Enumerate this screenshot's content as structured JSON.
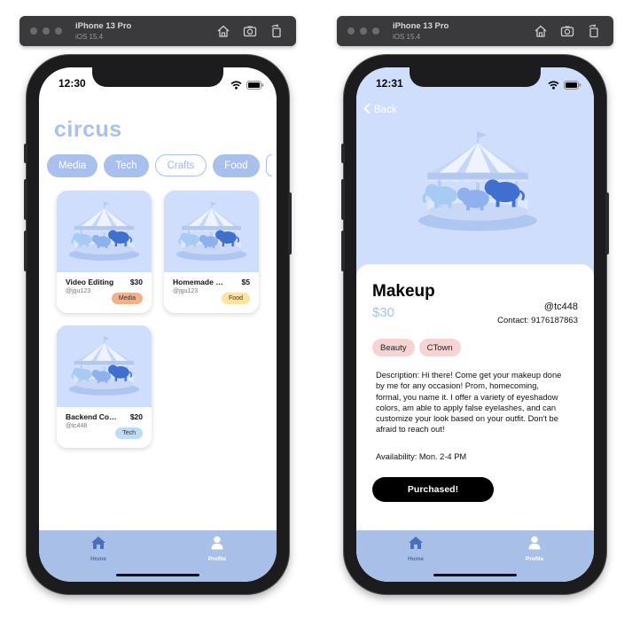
{
  "simulators": [
    {
      "device": "iPhone 13 Pro",
      "os": "iOS 15.4"
    },
    {
      "device": "iPhone 13 Pro",
      "os": "iOS 15.4"
    }
  ],
  "home_screen": {
    "time": "12:30",
    "logo": "circus",
    "categories": [
      "Media",
      "Tech",
      "Crafts",
      "Food"
    ],
    "listings": [
      {
        "title": "Video Editing",
        "price": "$30",
        "user": "@jgu123",
        "tag": "Media",
        "tag_color": "#f4b08a"
      },
      {
        "title": "Homemade Co...",
        "price": "$5",
        "user": "@jgu123",
        "tag": "Food",
        "tag_color": "#fde3a2"
      },
      {
        "title": "Backend Cours...",
        "price": "$20",
        "user": "@tc448",
        "tag": "Tech",
        "tag_color": "#bfdcf7"
      }
    ],
    "tabbar": [
      {
        "label": "Home",
        "icon": "house-icon"
      },
      {
        "label": "Profile",
        "icon": "person-icon"
      }
    ]
  },
  "detail_screen": {
    "time": "12:31",
    "back_label": "Back",
    "title": "Makeup",
    "price": "$30",
    "user": "@tc448",
    "contact": "Contact: 9176187863",
    "tags": [
      "Beauty",
      "CTown"
    ],
    "description": "Description: Hi there! Come get your makeup done by me for any occasion! Prom, homecoming, formal, you name it. I offer a variety of eyeshadow colors, am able to apply false eyelashes, and can customize your look based on your outfit. Don't be afraid to reach out!",
    "availability": "Availability: Mon. 2-4 PM",
    "button_label": "Purchased!",
    "tabbar": [
      {
        "label": "Home",
        "icon": "house-icon"
      },
      {
        "label": "Profile",
        "icon": "person-icon"
      }
    ]
  },
  "colors": {
    "accent": "#a9c0ec",
    "tabbar": "#a8bfe8",
    "card_bg": "#cfdefc",
    "tab_active": "#4a6fc0",
    "tab_inactive": "#ffffff"
  }
}
